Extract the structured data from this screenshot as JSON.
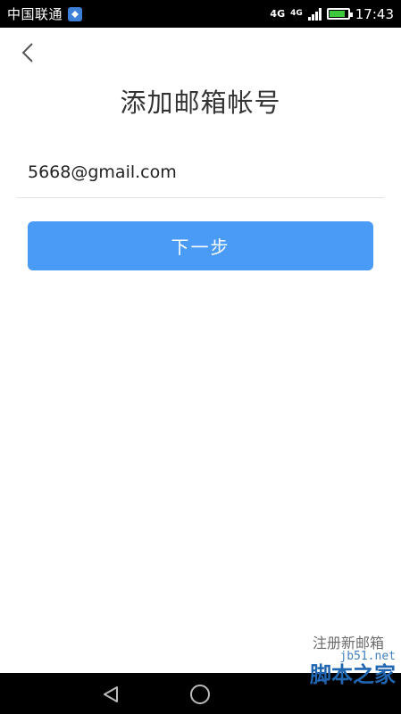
{
  "status_bar": {
    "carrier": "中国联通",
    "network_type_1": "4G",
    "network_type_2": "4G",
    "battery_level": 0.85,
    "time": "17:43"
  },
  "header": {
    "back_icon": "chevron-left-icon",
    "title": "添加邮箱帐号"
  },
  "form": {
    "email_value": "5668@gmail.com",
    "next_label": "下一步"
  },
  "footer": {
    "register_label": "注册新邮箱"
  },
  "watermark": {
    "site": "jb51.net",
    "name": "脚本之家"
  },
  "colors": {
    "accent": "#4a9bf5",
    "title_text": "#333333",
    "link_text": "#6b6b6b"
  }
}
